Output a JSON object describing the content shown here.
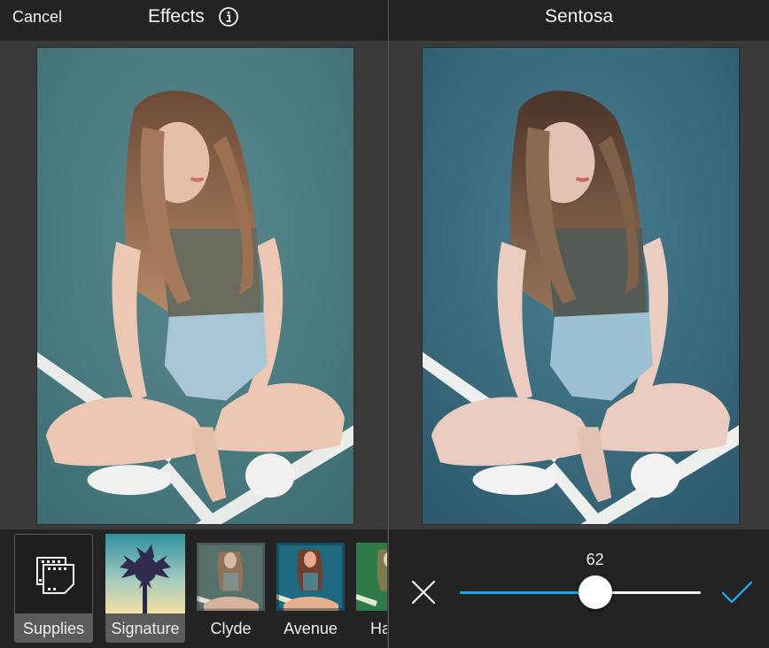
{
  "left_screen": {
    "header": {
      "cancel_label": "Cancel",
      "title": "Effects",
      "info_icon": "info-circle-icon"
    },
    "photo": {
      "description": "Woman sitting cross-legged on teal court",
      "filter": "original"
    },
    "effects": [
      {
        "label": "Supplies",
        "icon": "film-frames-icon",
        "selected": true
      },
      {
        "label": "Signature",
        "thumbnail": "palm-tree-sunset",
        "selected": true
      },
      {
        "label": "Clyde",
        "thumbnail": "portrait-muted",
        "selected": false
      },
      {
        "label": "Avenue",
        "thumbnail": "portrait-vivid",
        "selected": false
      },
      {
        "label": "Ha",
        "thumbnail": "portrait-green",
        "selected": false,
        "truncated": true
      }
    ]
  },
  "right_screen": {
    "header": {
      "title": "Sentosa"
    },
    "photo": {
      "description": "Woman sitting cross-legged on teal court",
      "filter": "Sentosa"
    },
    "slider": {
      "value": "62",
      "value_fraction": 0.62,
      "cancel_icon": "close-x-icon",
      "confirm_icon": "checkmark-icon"
    }
  },
  "colors": {
    "accent": "#1ea5e6",
    "topbar": "#232323",
    "canvas": "#3a3a3a",
    "court_original": "#4f7f85",
    "court_sentosa": "#3f7186"
  }
}
